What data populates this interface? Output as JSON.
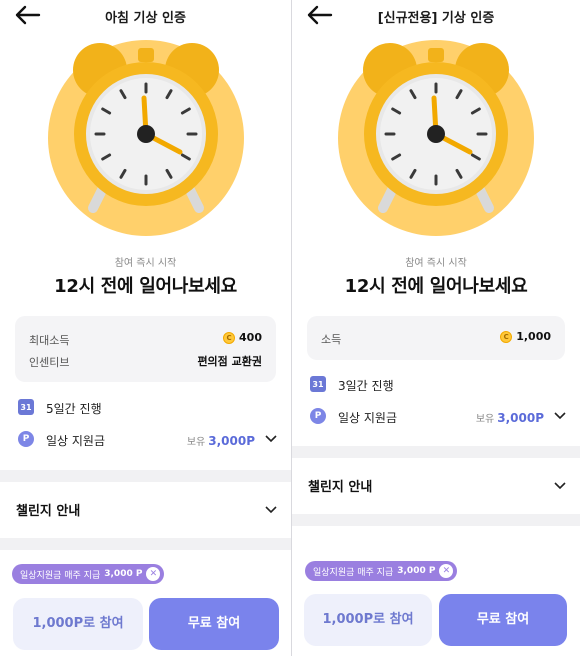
{
  "left": {
    "title": "아침 기상 인증",
    "subtitle": "참여 즉시 시작",
    "headline": "12시 전에 일어나보세요",
    "info": [
      {
        "label": "최대소득",
        "value": "400",
        "coin": true
      },
      {
        "label": "인센티브",
        "value": "편의점 교환권",
        "coin": false
      }
    ],
    "duration": "5일간 진행",
    "calendar_day": "31",
    "support": {
      "label": "일상 지원금",
      "hold_prefix": "보유",
      "hold_amount": "3,000P"
    },
    "guide": "챌린지 안내",
    "pill": {
      "text": "일상지원금 매주 지급",
      "amount": "3,000 P"
    },
    "btn_points": "1,000P로 참여",
    "btn_free": "무료 참여"
  },
  "right": {
    "title": "[신규전용] 기상 인증",
    "subtitle": "참여 즉시 시작",
    "headline": "12시 전에 일어나보세요",
    "info": [
      {
        "label": "소득",
        "value": "1,000",
        "coin": true
      }
    ],
    "duration": "3일간 진행",
    "calendar_day": "31",
    "support": {
      "label": "일상 지원금",
      "hold_prefix": "보유",
      "hold_amount": "3,000P"
    },
    "guide": "챌린지 안내",
    "pill": {
      "text": "일상지원금 매주 지급",
      "amount": "3,000 P"
    },
    "btn_points": "1,000P로 참여",
    "btn_free": "무료 참여"
  },
  "icons": {
    "back": "arrow-left-icon",
    "alarm": "alarm-clock-illustration",
    "calendar": "calendar-icon",
    "points": "p-coin-icon",
    "chevron": "chevron-down-icon",
    "close": "close-icon",
    "coin": "coin-icon"
  },
  "colors": {
    "accent": "#7a83ec",
    "accent_light": "#eef0fb",
    "pill": "#9a7fe0",
    "clock_yellow": "#f6b820",
    "hero_bg": "#ffd06b"
  }
}
